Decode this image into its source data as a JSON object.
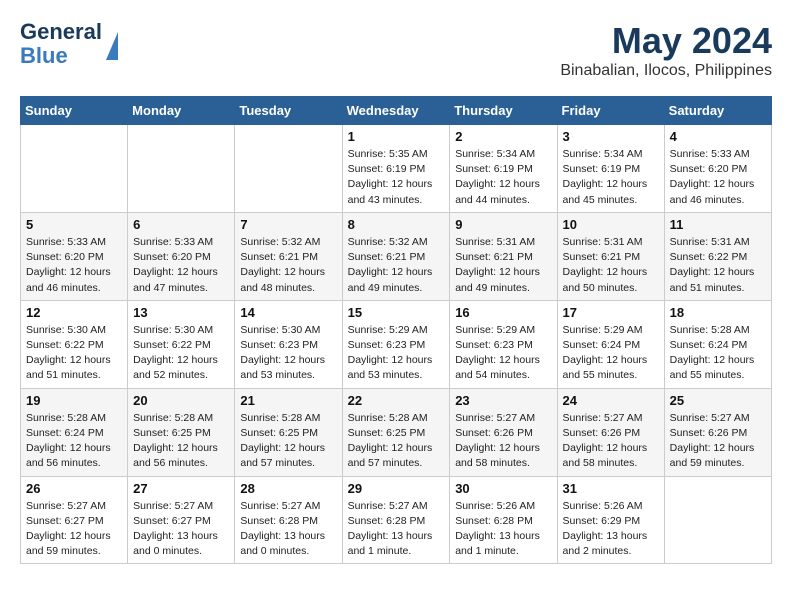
{
  "logo": {
    "line1": "General",
    "line2": "Blue"
  },
  "title": {
    "month_year": "May 2024",
    "location": "Binabalian, Ilocos, Philippines"
  },
  "days_of_week": [
    "Sunday",
    "Monday",
    "Tuesday",
    "Wednesday",
    "Thursday",
    "Friday",
    "Saturday"
  ],
  "weeks": [
    [
      {
        "day": "",
        "info": ""
      },
      {
        "day": "",
        "info": ""
      },
      {
        "day": "",
        "info": ""
      },
      {
        "day": "1",
        "info": "Sunrise: 5:35 AM\nSunset: 6:19 PM\nDaylight: 12 hours\nand 43 minutes."
      },
      {
        "day": "2",
        "info": "Sunrise: 5:34 AM\nSunset: 6:19 PM\nDaylight: 12 hours\nand 44 minutes."
      },
      {
        "day": "3",
        "info": "Sunrise: 5:34 AM\nSunset: 6:19 PM\nDaylight: 12 hours\nand 45 minutes."
      },
      {
        "day": "4",
        "info": "Sunrise: 5:33 AM\nSunset: 6:20 PM\nDaylight: 12 hours\nand 46 minutes."
      }
    ],
    [
      {
        "day": "5",
        "info": "Sunrise: 5:33 AM\nSunset: 6:20 PM\nDaylight: 12 hours\nand 46 minutes."
      },
      {
        "day": "6",
        "info": "Sunrise: 5:33 AM\nSunset: 6:20 PM\nDaylight: 12 hours\nand 47 minutes."
      },
      {
        "day": "7",
        "info": "Sunrise: 5:32 AM\nSunset: 6:21 PM\nDaylight: 12 hours\nand 48 minutes."
      },
      {
        "day": "8",
        "info": "Sunrise: 5:32 AM\nSunset: 6:21 PM\nDaylight: 12 hours\nand 49 minutes."
      },
      {
        "day": "9",
        "info": "Sunrise: 5:31 AM\nSunset: 6:21 PM\nDaylight: 12 hours\nand 49 minutes."
      },
      {
        "day": "10",
        "info": "Sunrise: 5:31 AM\nSunset: 6:21 PM\nDaylight: 12 hours\nand 50 minutes."
      },
      {
        "day": "11",
        "info": "Sunrise: 5:31 AM\nSunset: 6:22 PM\nDaylight: 12 hours\nand 51 minutes."
      }
    ],
    [
      {
        "day": "12",
        "info": "Sunrise: 5:30 AM\nSunset: 6:22 PM\nDaylight: 12 hours\nand 51 minutes."
      },
      {
        "day": "13",
        "info": "Sunrise: 5:30 AM\nSunset: 6:22 PM\nDaylight: 12 hours\nand 52 minutes."
      },
      {
        "day": "14",
        "info": "Sunrise: 5:30 AM\nSunset: 6:23 PM\nDaylight: 12 hours\nand 53 minutes."
      },
      {
        "day": "15",
        "info": "Sunrise: 5:29 AM\nSunset: 6:23 PM\nDaylight: 12 hours\nand 53 minutes."
      },
      {
        "day": "16",
        "info": "Sunrise: 5:29 AM\nSunset: 6:23 PM\nDaylight: 12 hours\nand 54 minutes."
      },
      {
        "day": "17",
        "info": "Sunrise: 5:29 AM\nSunset: 6:24 PM\nDaylight: 12 hours\nand 55 minutes."
      },
      {
        "day": "18",
        "info": "Sunrise: 5:28 AM\nSunset: 6:24 PM\nDaylight: 12 hours\nand 55 minutes."
      }
    ],
    [
      {
        "day": "19",
        "info": "Sunrise: 5:28 AM\nSunset: 6:24 PM\nDaylight: 12 hours\nand 56 minutes."
      },
      {
        "day": "20",
        "info": "Sunrise: 5:28 AM\nSunset: 6:25 PM\nDaylight: 12 hours\nand 56 minutes."
      },
      {
        "day": "21",
        "info": "Sunrise: 5:28 AM\nSunset: 6:25 PM\nDaylight: 12 hours\nand 57 minutes."
      },
      {
        "day": "22",
        "info": "Sunrise: 5:28 AM\nSunset: 6:25 PM\nDaylight: 12 hours\nand 57 minutes."
      },
      {
        "day": "23",
        "info": "Sunrise: 5:27 AM\nSunset: 6:26 PM\nDaylight: 12 hours\nand 58 minutes."
      },
      {
        "day": "24",
        "info": "Sunrise: 5:27 AM\nSunset: 6:26 PM\nDaylight: 12 hours\nand 58 minutes."
      },
      {
        "day": "25",
        "info": "Sunrise: 5:27 AM\nSunset: 6:26 PM\nDaylight: 12 hours\nand 59 minutes."
      }
    ],
    [
      {
        "day": "26",
        "info": "Sunrise: 5:27 AM\nSunset: 6:27 PM\nDaylight: 12 hours\nand 59 minutes."
      },
      {
        "day": "27",
        "info": "Sunrise: 5:27 AM\nSunset: 6:27 PM\nDaylight: 13 hours\nand 0 minutes."
      },
      {
        "day": "28",
        "info": "Sunrise: 5:27 AM\nSunset: 6:28 PM\nDaylight: 13 hours\nand 0 minutes."
      },
      {
        "day": "29",
        "info": "Sunrise: 5:27 AM\nSunset: 6:28 PM\nDaylight: 13 hours\nand 1 minute."
      },
      {
        "day": "30",
        "info": "Sunrise: 5:26 AM\nSunset: 6:28 PM\nDaylight: 13 hours\nand 1 minute."
      },
      {
        "day": "31",
        "info": "Sunrise: 5:26 AM\nSunset: 6:29 PM\nDaylight: 13 hours\nand 2 minutes."
      },
      {
        "day": "",
        "info": ""
      }
    ]
  ]
}
